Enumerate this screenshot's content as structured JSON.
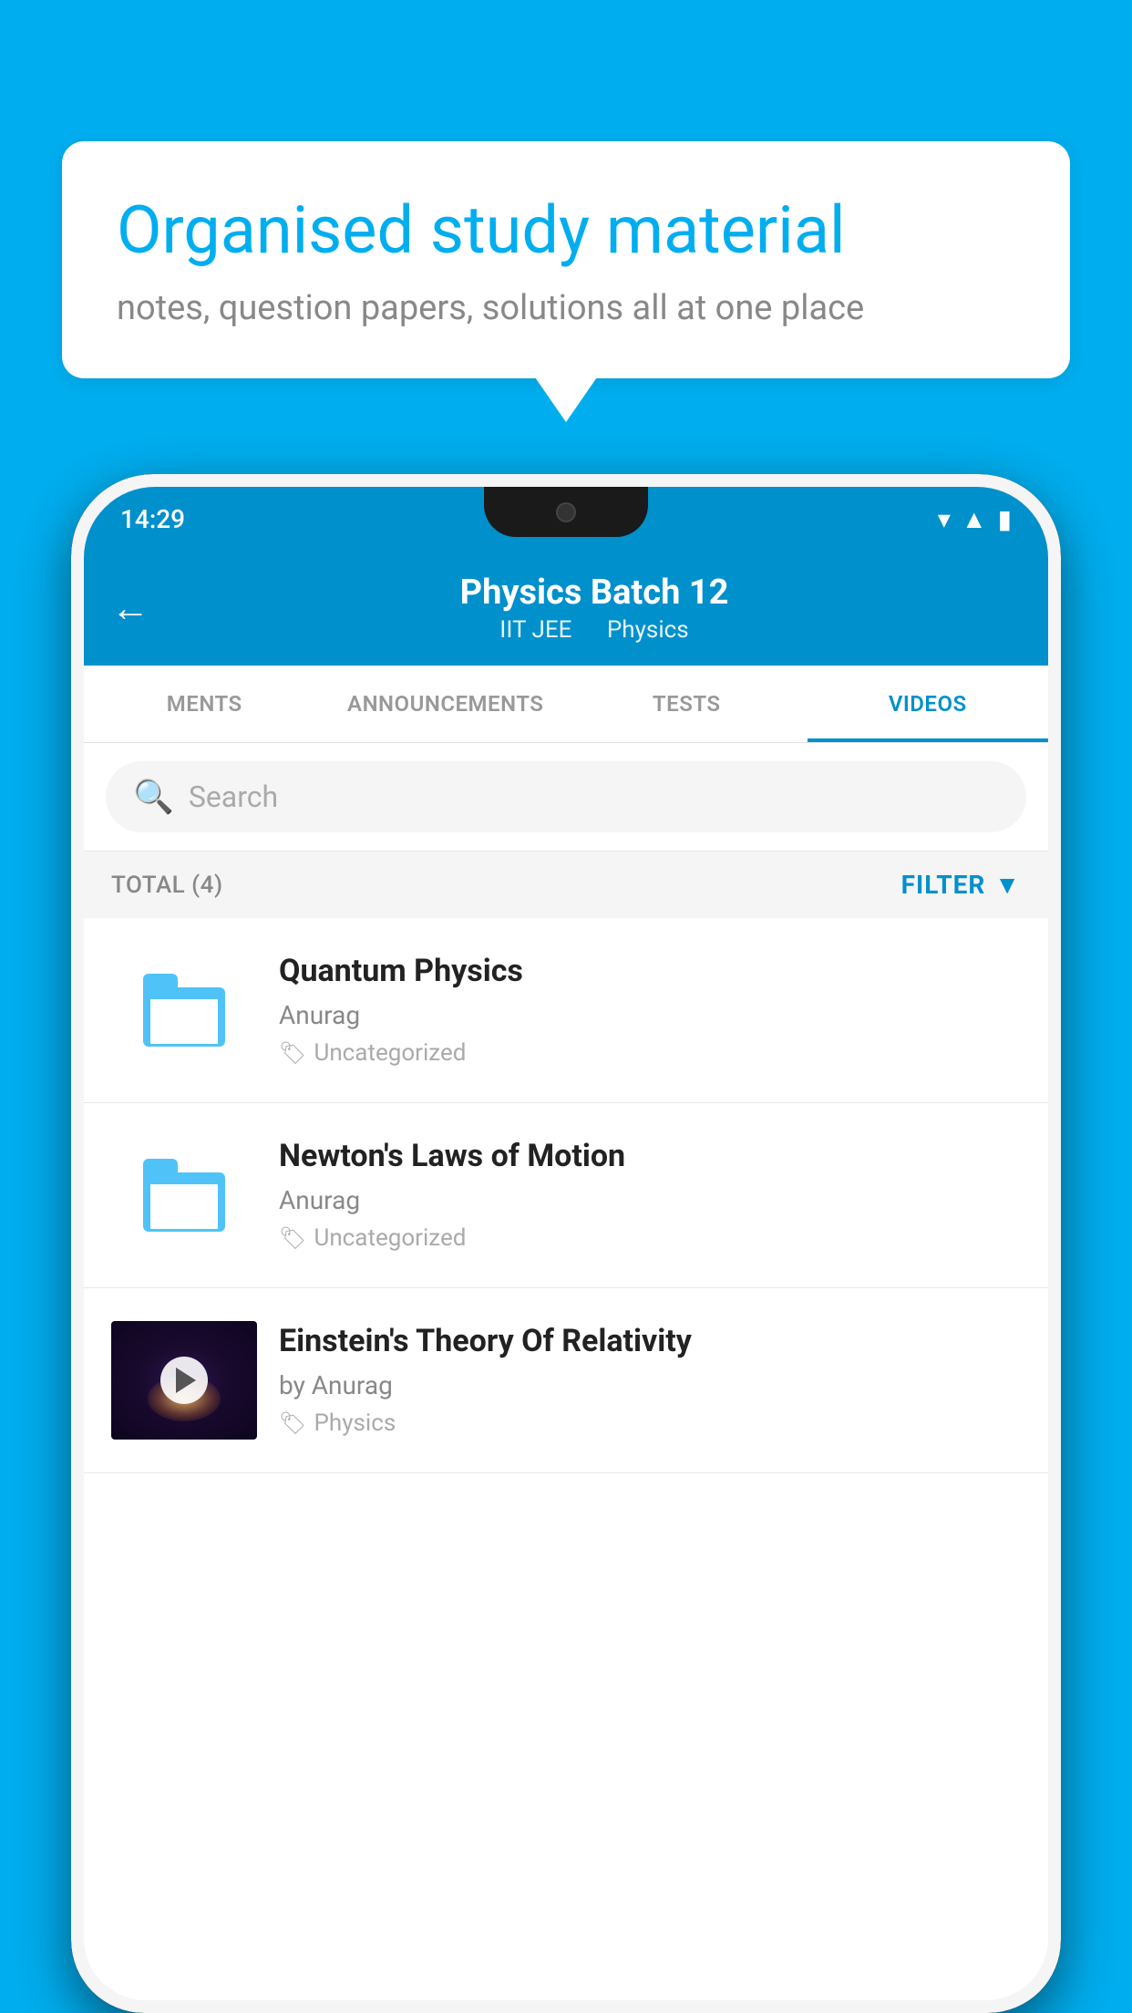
{
  "background_color": "#00AEEF",
  "speech_bubble": {
    "title": "Organised study material",
    "subtitle": "notes, question papers, solutions all at one place"
  },
  "phone": {
    "status_bar": {
      "time": "14:29",
      "icons": [
        "wifi",
        "signal",
        "battery"
      ]
    },
    "header": {
      "title": "Physics Batch 12",
      "subtitle_part1": "IIT JEE",
      "subtitle_part2": "Physics",
      "back_label": "←"
    },
    "tabs": [
      {
        "label": "MENTS",
        "active": false
      },
      {
        "label": "ANNOUNCEMENTS",
        "active": false
      },
      {
        "label": "TESTS",
        "active": false
      },
      {
        "label": "VIDEOS",
        "active": true
      }
    ],
    "search": {
      "placeholder": "Search"
    },
    "filter_bar": {
      "total_label": "TOTAL (4)",
      "filter_label": "FILTER"
    },
    "videos": [
      {
        "title": "Quantum Physics",
        "author": "Anurag",
        "tag": "Uncategorized",
        "has_thumbnail": false,
        "thumbnail_type": "folder"
      },
      {
        "title": "Newton's Laws of Motion",
        "author": "Anurag",
        "tag": "Uncategorized",
        "has_thumbnail": false,
        "thumbnail_type": "folder"
      },
      {
        "title": "Einstein's Theory Of Relativity",
        "author": "by Anurag",
        "tag": "Physics",
        "has_thumbnail": true,
        "thumbnail_type": "space"
      }
    ]
  }
}
